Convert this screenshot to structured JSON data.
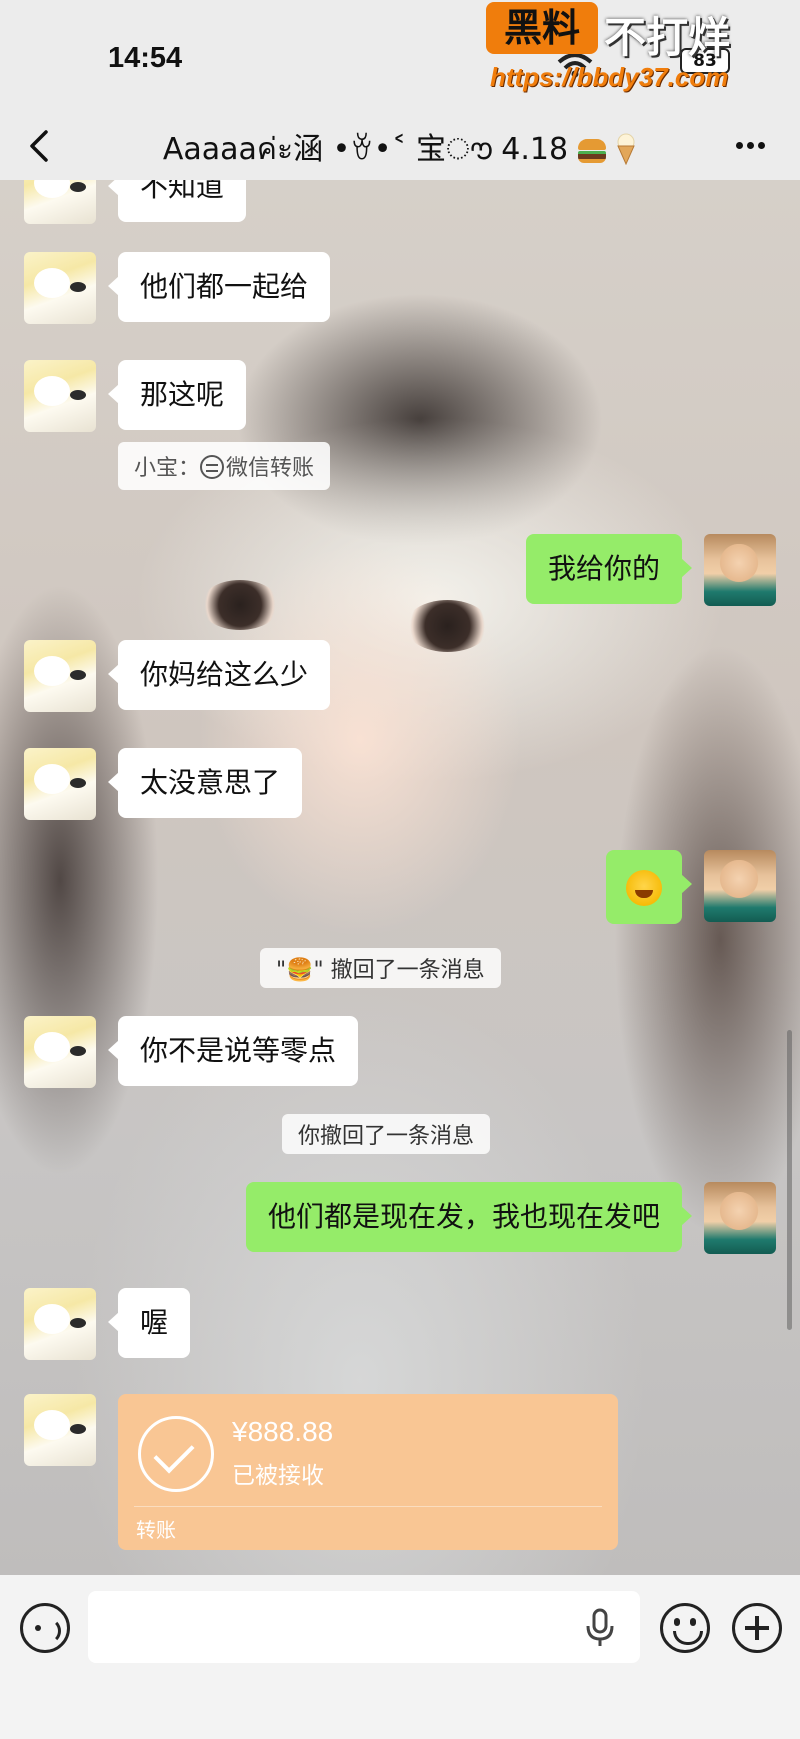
{
  "status_bar": {
    "time": "14:54",
    "battery": "83",
    "watermark": {
      "badge": "黑料",
      "title": "不打烊",
      "url": "https://bbdy37.com"
    }
  },
  "header": {
    "title": "Aaaaaค่ะ涵 •ꈊ•˂ 宝ൗ 4.18",
    "back_icon": "chevron-left-icon",
    "more_icon": "more-dots-icon",
    "title_emojis": [
      "hamburger",
      "ice-cream"
    ]
  },
  "messages": [
    {
      "side": "left",
      "text": "不知道"
    },
    {
      "side": "left",
      "text": "他们都一起给"
    },
    {
      "side": "left",
      "text": "那这呢"
    },
    {
      "type": "quote",
      "text": "小宝：",
      "quoted": "微信转账"
    },
    {
      "side": "right",
      "text": "我给你的"
    },
    {
      "side": "left",
      "text": "你妈给这么少"
    },
    {
      "side": "left",
      "text": "太没意思了"
    },
    {
      "side": "right",
      "emoji": "face-with-tears-of-joy"
    },
    {
      "type": "system",
      "text": "\"🍔\" 撤回了一条消息"
    },
    {
      "side": "left",
      "text": "你不是说等零点"
    },
    {
      "type": "system",
      "text": "你撤回了一条消息"
    },
    {
      "side": "right",
      "text": "他们都是现在发，我也现在发吧"
    },
    {
      "side": "left",
      "text": "喔"
    },
    {
      "type": "transfer",
      "amount": "¥888.88",
      "status": "已被接收",
      "label": "转账"
    }
  ],
  "input_bar": {
    "placeholder": "",
    "icons": [
      "voice-icon",
      "mic-icon",
      "emoji-icon",
      "plus-icon"
    ]
  },
  "colors": {
    "self_bubble": "#95ec69",
    "other_bubble": "#ffffff",
    "transfer_card": "#f9c694",
    "watermark_orange": "#f07d0c"
  }
}
